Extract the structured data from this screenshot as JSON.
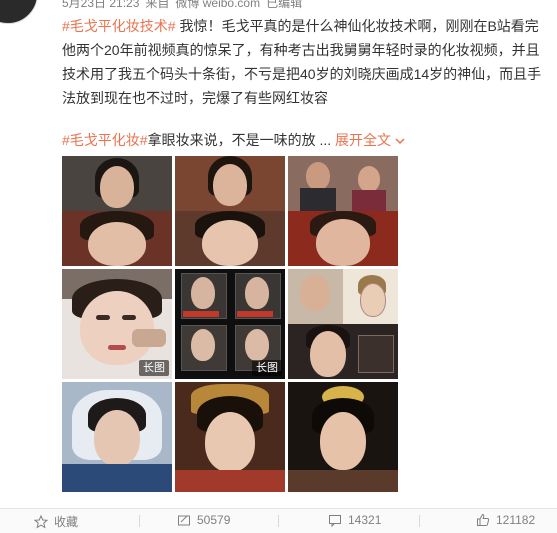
{
  "meta": {
    "date": "5月23日 21:23",
    "source_prefix": "来自",
    "source": "微博 weibo.com",
    "status": "已编辑"
  },
  "post": {
    "hashtag": "#毛戈平化妆技术#",
    "text": " 我惊！毛戈平真的是什么神仙化妆技术啊，刚刚在B站看完他两个20年前视频真的惊呆了，有种考古出我舅舅年轻时录的化妆视频，并且技术用了我五个码头十条街，不亏是把40岁的刘晓庆画成14岁的神仙，而且手法放到现在也不过时，完爆了有些网红妆容",
    "hashtag2": "#毛戈平化妆#",
    "text2": "拿眼妆来说，不是一味的放 ...",
    "expand_label": "展开全文",
    "expand_icon": "chevron-down-icon"
  },
  "images": [
    {
      "badge": ""
    },
    {
      "badge": ""
    },
    {
      "badge": ""
    },
    {
      "badge": "长图"
    },
    {
      "badge": "长图"
    },
    {
      "badge": ""
    },
    {
      "badge": ""
    },
    {
      "badge": ""
    },
    {
      "badge": ""
    }
  ],
  "actions": {
    "favorite": {
      "label": "收藏",
      "icon": "star-icon"
    },
    "repost": {
      "count": "50579",
      "icon": "repost-icon"
    },
    "comment": {
      "count": "14321",
      "icon": "comment-icon"
    },
    "like": {
      "count": "121182",
      "icon": "thumbs-up-icon"
    }
  },
  "colors": {
    "link": "#eb7350",
    "text": "#333333",
    "muted": "#808080"
  }
}
